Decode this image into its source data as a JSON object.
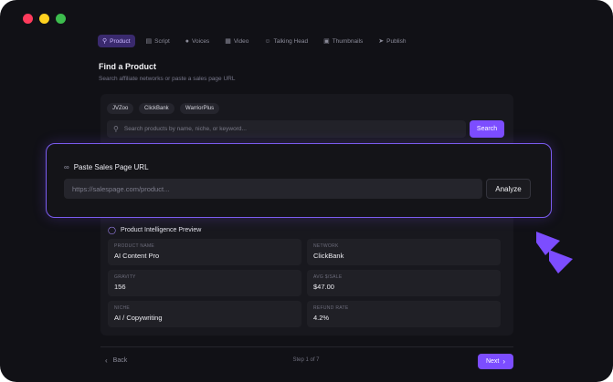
{
  "window": {
    "controls": {
      "close_color": "#ff3b5c",
      "minimize_color": "#ffd21f",
      "zoom_color": "#3dbd4e"
    }
  },
  "tabs": [
    {
      "label": "Product",
      "icon": "search-icon",
      "active": true
    },
    {
      "label": "Script",
      "icon": "document-icon",
      "active": false
    },
    {
      "label": "Voices",
      "icon": "microphone-icon",
      "active": false
    },
    {
      "label": "Video",
      "icon": "film-icon",
      "active": false
    },
    {
      "label": "Talking Head",
      "icon": "face-icon",
      "active": false
    },
    {
      "label": "Thumbnails",
      "icon": "image-icon",
      "active": false
    },
    {
      "label": "Publish",
      "icon": "send-icon",
      "active": false
    }
  ],
  "header": {
    "title": "Find a Product",
    "subtitle": "Search affiliate networks or paste a sales page URL"
  },
  "networks": [
    "JVZoo",
    "ClickBank",
    "WarriorPlus"
  ],
  "search": {
    "placeholder": "Search products by name, niche, or keyword...",
    "button_label": "Search",
    "icon": "search-icon"
  },
  "sales_page": {
    "title": "Paste Sales Page URL",
    "icon": "link-icon",
    "url_placeholder": "https://salespage.com/product...",
    "analyze_label": "Analyze"
  },
  "intelligence": {
    "title": "Product Intelligence Preview",
    "icon": "globe-icon",
    "fields": [
      {
        "label": "PRODUCT NAME",
        "value": "AI Content Pro"
      },
      {
        "label": "NETWORK",
        "value": "ClickBank"
      },
      {
        "label": "GRAVITY",
        "value": "156"
      },
      {
        "label": "AVG $/SALE",
        "value": "$47.00"
      },
      {
        "label": "NICHE",
        "value": "AI / Copywriting"
      },
      {
        "label": "REFUND RATE",
        "value": "4.2%"
      }
    ]
  },
  "footer": {
    "back_label": "Back",
    "step_text": "Step 1 of 7",
    "next_label": "Next"
  },
  "colors": {
    "accent": "#7c4dff",
    "background": "#111116",
    "panel": "#18181e",
    "overlay_border": "#7b5cf0"
  }
}
